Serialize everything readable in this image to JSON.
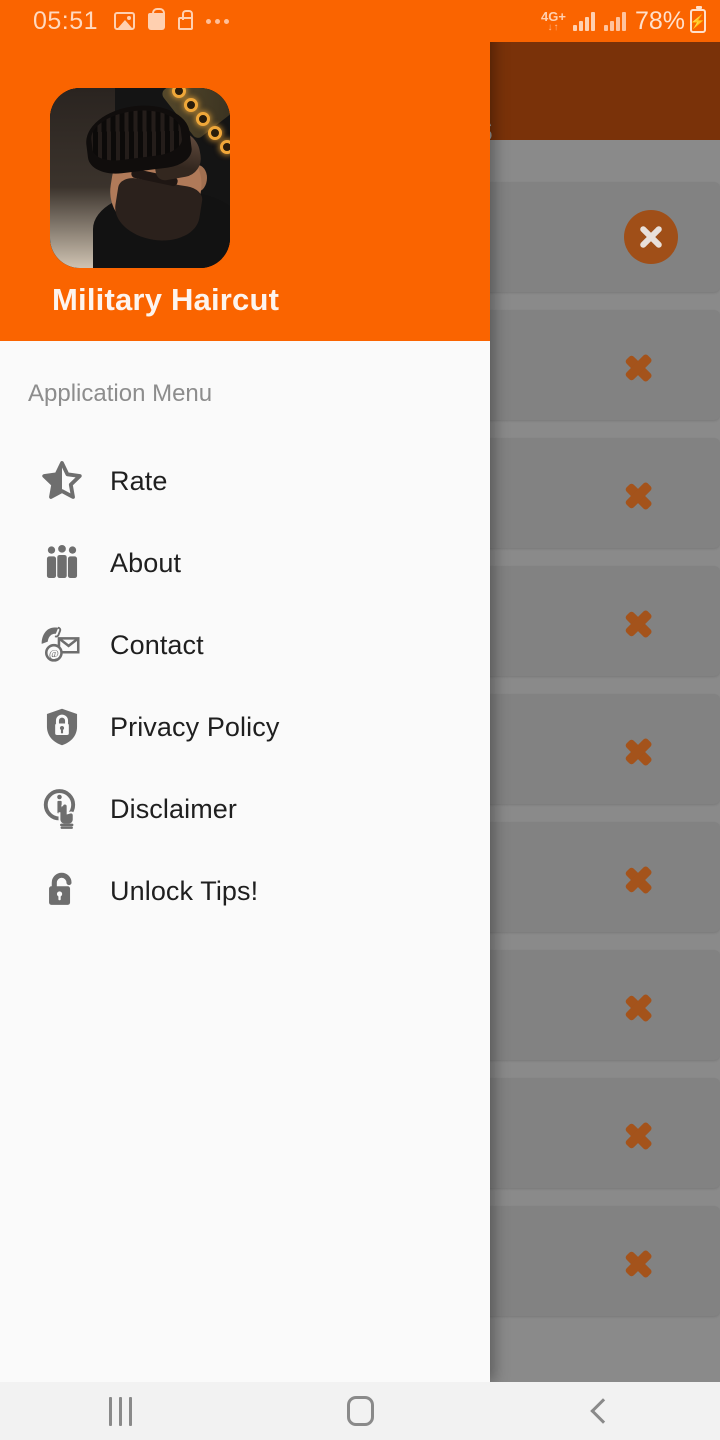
{
  "status_bar": {
    "time": "05:51",
    "icons": [
      "gallery-icon",
      "shopping-bag-icon",
      "lock-icon",
      "more-dots-icon"
    ],
    "network_type": "4G+",
    "network_arrows": "↓↑",
    "battery_percent": "78%",
    "battery_state": "charging",
    "background_color": "#FA6400",
    "text_color": "#FFD9BF"
  },
  "drawer": {
    "app_title": "Military Haircut",
    "app_icon": "app-logo-barber-photo",
    "header_color": "#FA6400",
    "panel_color": "#FAFAFA",
    "section_title": "Application Menu",
    "items": [
      {
        "label": "Rate",
        "icon": "star-half-icon"
      },
      {
        "label": "About",
        "icon": "people-group-icon"
      },
      {
        "label": "Contact",
        "icon": "phone-envelope-at-icon"
      },
      {
        "label": "Privacy Policy",
        "icon": "shield-lock-icon"
      },
      {
        "label": "Disclaimer",
        "icon": "info-hand-pointer-icon"
      },
      {
        "label": "Unlock Tips!",
        "icon": "open-padlock-icon"
      }
    ]
  },
  "background_app": {
    "appbar_title_fragment": "s",
    "appbar_color": "#7A3209",
    "scrim_color": "#8A8A8A",
    "chevron_color": "#A4531B",
    "close_button": "close-circle-icon",
    "rows": [
      {
        "trailing": "close-circle-icon"
      },
      {
        "trailing": "chevron-right-icon"
      },
      {
        "trailing": "chevron-right-icon"
      },
      {
        "trailing": "chevron-right-icon"
      },
      {
        "trailing": "chevron-right-icon"
      },
      {
        "trailing": "chevron-right-icon"
      },
      {
        "trailing": "chevron-right-icon"
      },
      {
        "trailing": "chevron-right-icon"
      },
      {
        "trailing": "chevron-right-icon"
      }
    ]
  },
  "nav_bar": {
    "background_color": "#F2F2F2",
    "buttons": [
      {
        "name": "recents",
        "icon": "recents-icon"
      },
      {
        "name": "home",
        "icon": "home-icon"
      },
      {
        "name": "back",
        "icon": "back-chevron-icon"
      }
    ]
  }
}
